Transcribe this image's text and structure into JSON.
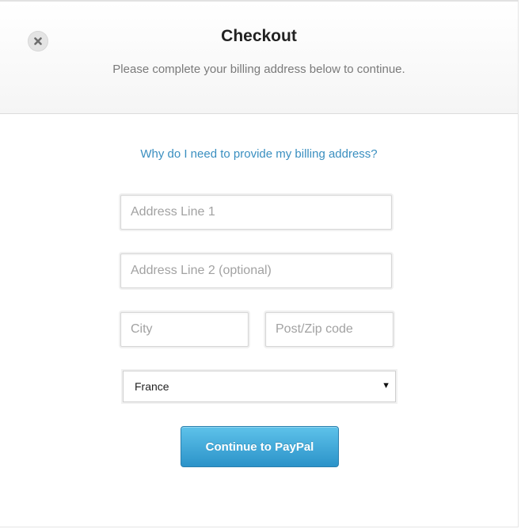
{
  "header": {
    "title": "Checkout",
    "subtitle": "Please complete your billing address below to continue."
  },
  "help_link": {
    "label": "Why do I need to provide my billing address?"
  },
  "form": {
    "address_line_1": {
      "placeholder": "Address Line 1",
      "value": ""
    },
    "address_line_2": {
      "placeholder": "Address Line 2 (optional)",
      "value": ""
    },
    "city": {
      "placeholder": "City",
      "value": ""
    },
    "postcode": {
      "placeholder": "Post/Zip code",
      "value": ""
    },
    "country": {
      "selected": "France"
    },
    "submit_label": "Continue to PayPal"
  },
  "icons": {
    "close": "close-icon",
    "dropdown": "caret-down-icon"
  },
  "colors": {
    "link": "#3a8fc0",
    "button_top": "#5ec2ea",
    "button_bottom": "#2b93c9",
    "title": "#222222",
    "subtitle": "#7a7a7a"
  }
}
